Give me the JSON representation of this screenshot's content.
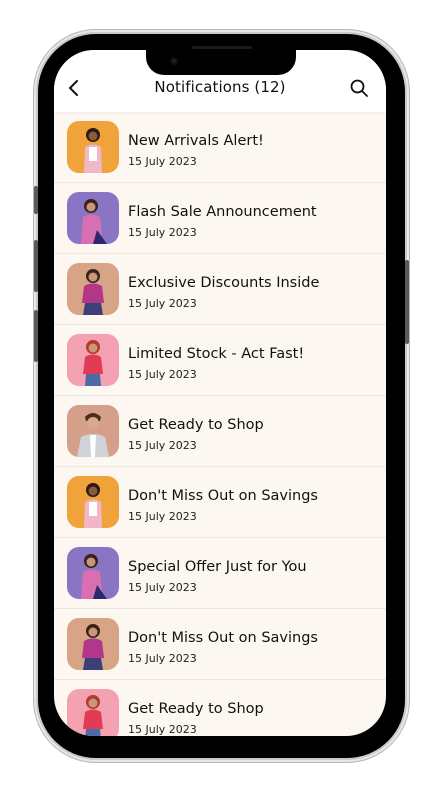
{
  "header": {
    "title": "Notifications (12)",
    "back_icon": "chevron-left-icon",
    "search_icon": "search-icon"
  },
  "colors": {
    "screen_bg": "#fdf7f1",
    "thumb_orange": "#f0a33a",
    "thumb_purple": "#8a74c4",
    "thumb_tan": "#d7a585",
    "thumb_pink": "#f4a1b2",
    "thumb_peach": "#d4a08a"
  },
  "notifications": [
    {
      "title": "New Arrivals Alert!",
      "date": "15 July 2023",
      "thumb": "orange"
    },
    {
      "title": "Flash Sale Announcement",
      "date": "15 July 2023",
      "thumb": "purple"
    },
    {
      "title": "Exclusive Discounts Inside",
      "date": "15 July 2023",
      "thumb": "tan"
    },
    {
      "title": "Limited Stock - Act Fast!",
      "date": "15 July 2023",
      "thumb": "pink"
    },
    {
      "title": "Get Ready to Shop",
      "date": "15 July 2023",
      "thumb": "peach"
    },
    {
      "title": "Don't Miss Out on Savings",
      "date": "15 July 2023",
      "thumb": "orange"
    },
    {
      "title": "Special Offer Just for You",
      "date": "15 July 2023",
      "thumb": "purple"
    },
    {
      "title": "Don't Miss Out on Savings",
      "date": "15 July 2023",
      "thumb": "tan"
    },
    {
      "title": "Get Ready to Shop",
      "date": "15 July 2023",
      "thumb": "pink"
    }
  ]
}
